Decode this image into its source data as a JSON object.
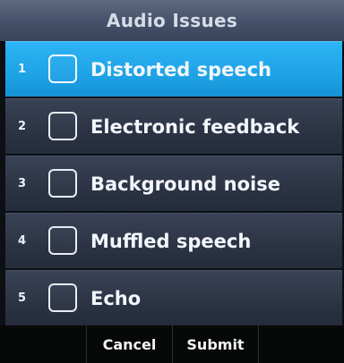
{
  "header": {
    "title": "Audio Issues"
  },
  "items": [
    {
      "number": "1",
      "label": "Distorted speech",
      "checked": false,
      "selected": true
    },
    {
      "number": "2",
      "label": "Electronic feedback",
      "checked": false,
      "selected": false
    },
    {
      "number": "3",
      "label": "Background noise",
      "checked": false,
      "selected": false
    },
    {
      "number": "4",
      "label": "Muffled speech",
      "checked": false,
      "selected": false
    },
    {
      "number": "5",
      "label": "Echo",
      "checked": false,
      "selected": false
    }
  ],
  "softkeys": [
    {
      "label": ""
    },
    {
      "label": "Cancel"
    },
    {
      "label": "Submit"
    },
    {
      "label": ""
    }
  ],
  "colors": {
    "selected_row": "#1ea3e6",
    "row": "#2b3344",
    "header": "#45516a"
  }
}
